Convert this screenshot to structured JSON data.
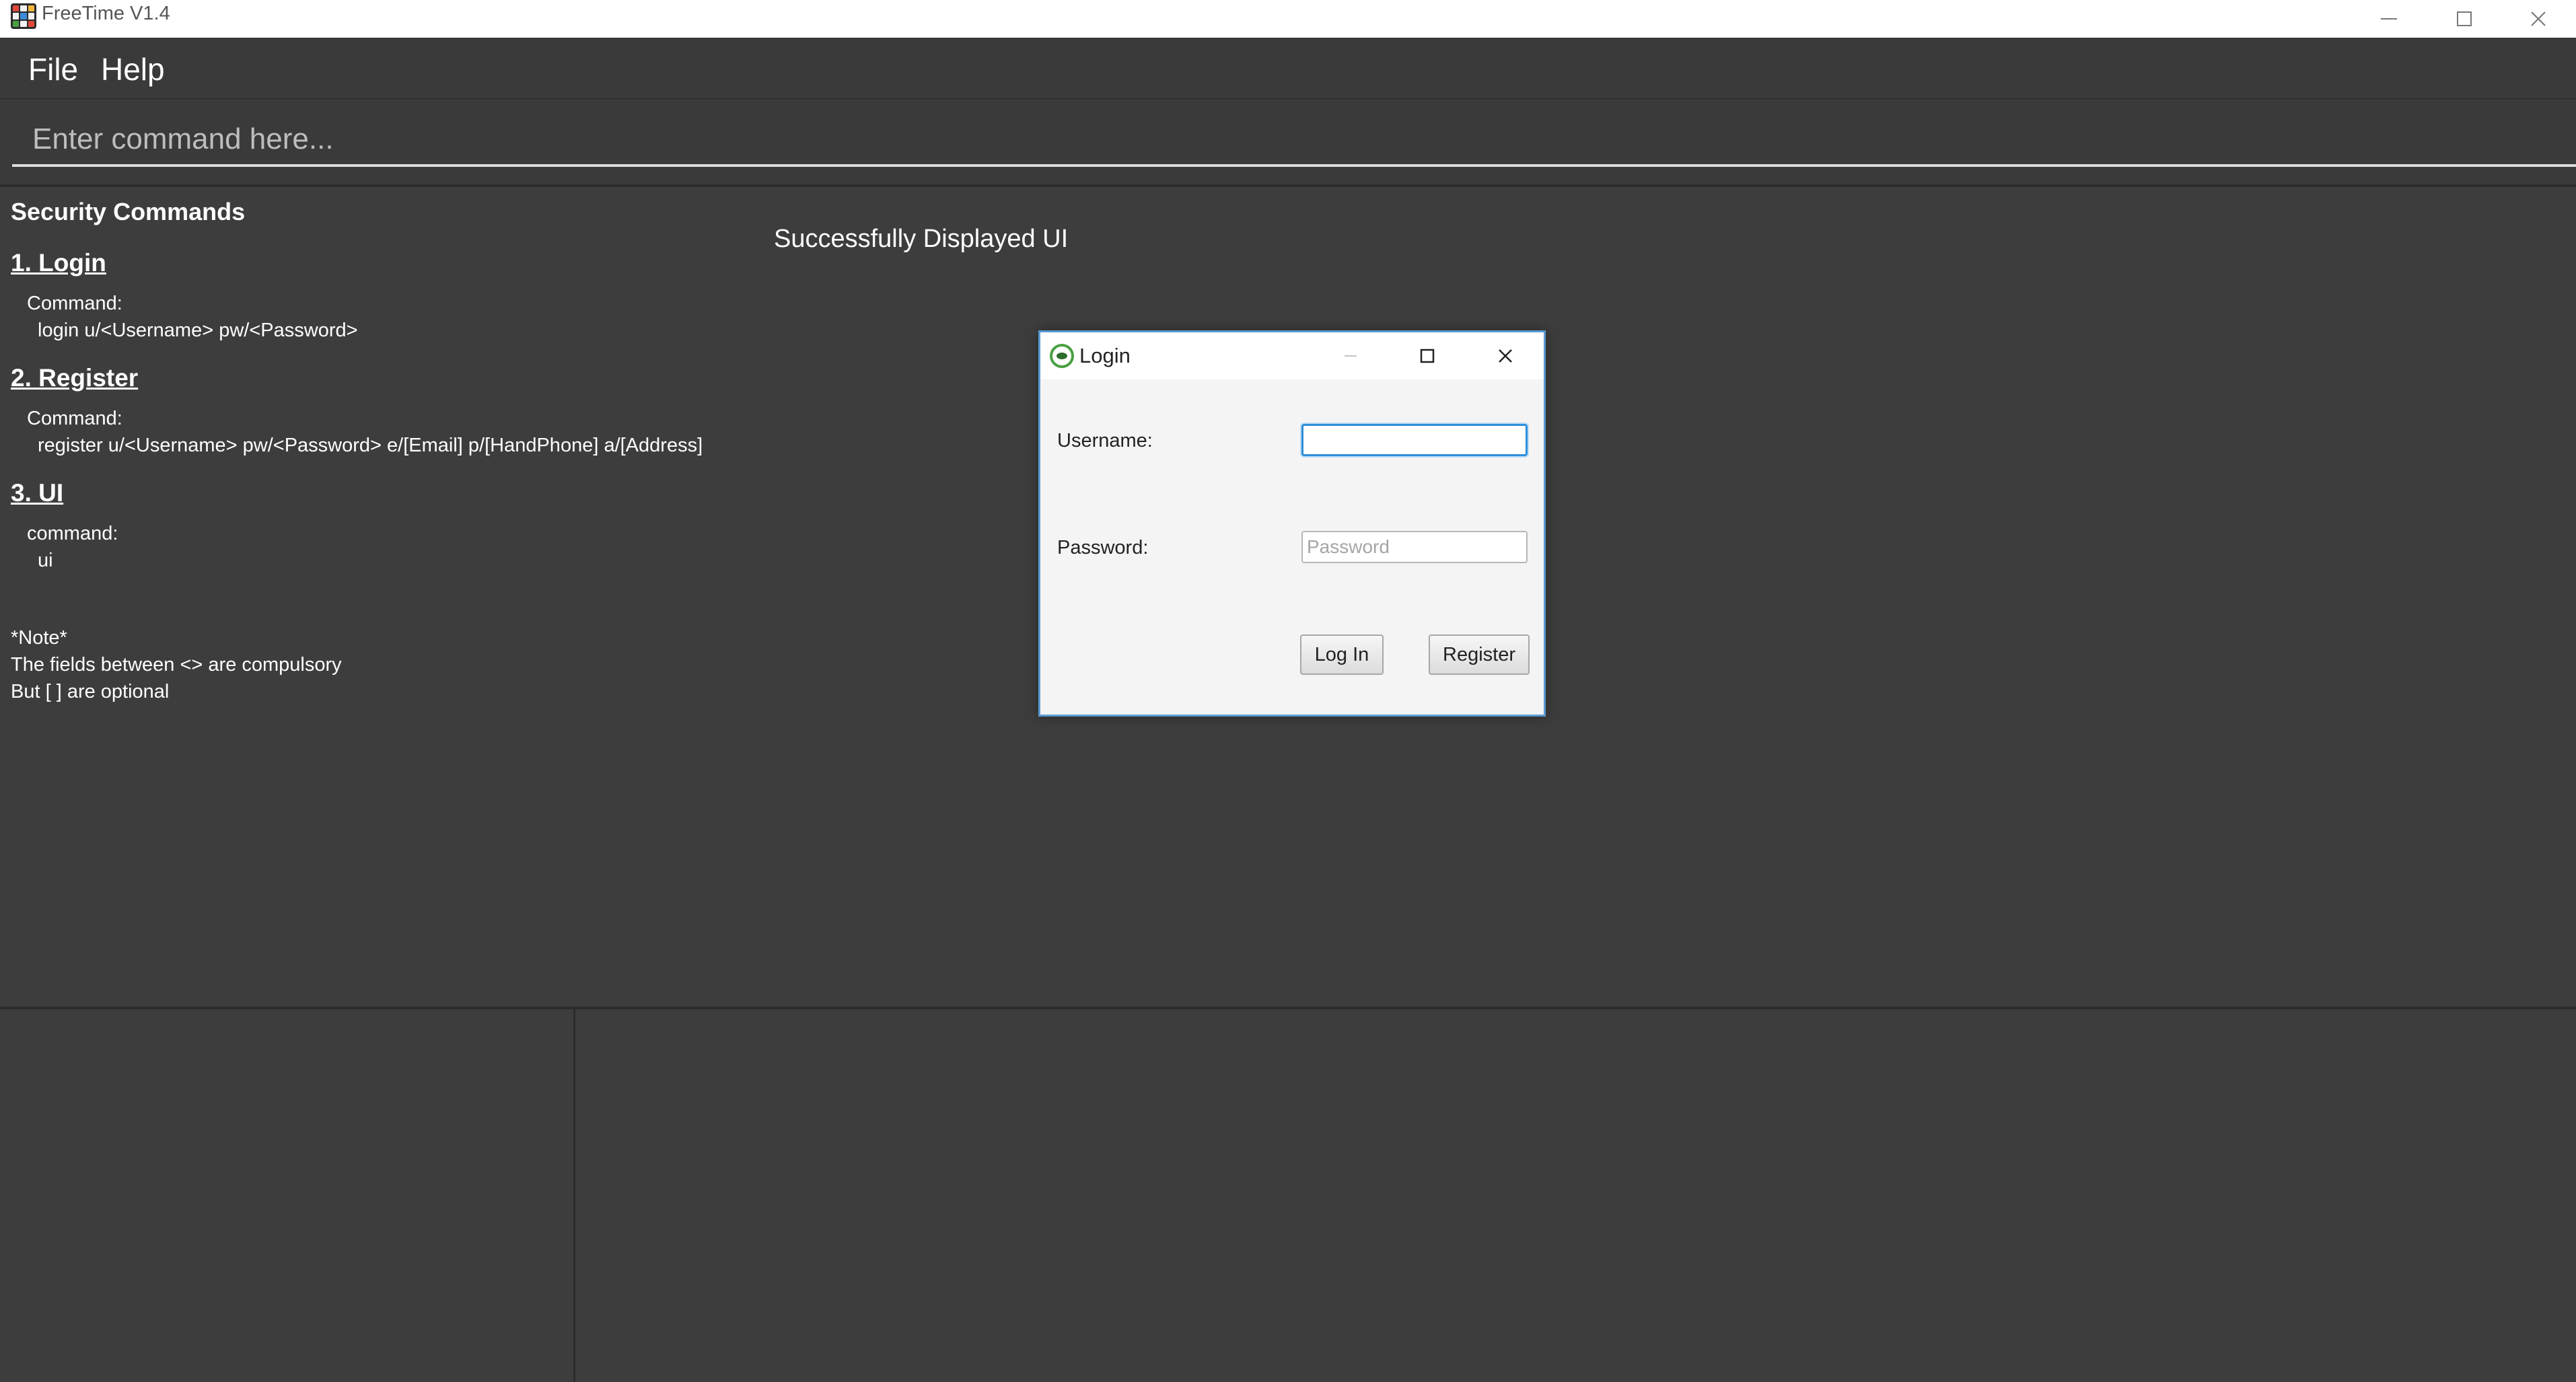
{
  "window": {
    "title": "FreeTime V1.4",
    "icon": "freetime-grid-icon",
    "controls": [
      "minimize-icon",
      "maximize-icon",
      "close-icon"
    ]
  },
  "menu": {
    "items": [
      {
        "label": "File"
      },
      {
        "label": "Help"
      }
    ]
  },
  "command_box": {
    "placeholder": "Enter command here...",
    "value": ""
  },
  "help_panel": {
    "title": "Security Commands",
    "sections": [
      {
        "heading": "1. Login",
        "label": "Command:",
        "command": "login u/<Username> pw/<Password>"
      },
      {
        "heading": "2. Register",
        "label": "Command:",
        "command": "register u/<Username> pw/<Password> e/[Email] p/[HandPhone] a/[Address]"
      },
      {
        "heading": "3. UI",
        "label": "command:",
        "command": "ui"
      }
    ],
    "note": {
      "title": "*Note*",
      "line1": "The fields between <> are compulsory",
      "line2": "But [ ] are optional"
    }
  },
  "result_display": {
    "text": "Successfully Displayed UI"
  },
  "login_dialog": {
    "title": "Login",
    "icon": "login-app-icon",
    "username_label": "Username:",
    "username_value": "",
    "username_placeholder": "",
    "password_label": "Password:",
    "password_placeholder": "Password",
    "login_button": "Log In",
    "register_button": "Register"
  },
  "colors": {
    "background": "#3d3d3d",
    "dialog_border": "#5b9bd5",
    "focus_ring": "#2f8ed8"
  }
}
